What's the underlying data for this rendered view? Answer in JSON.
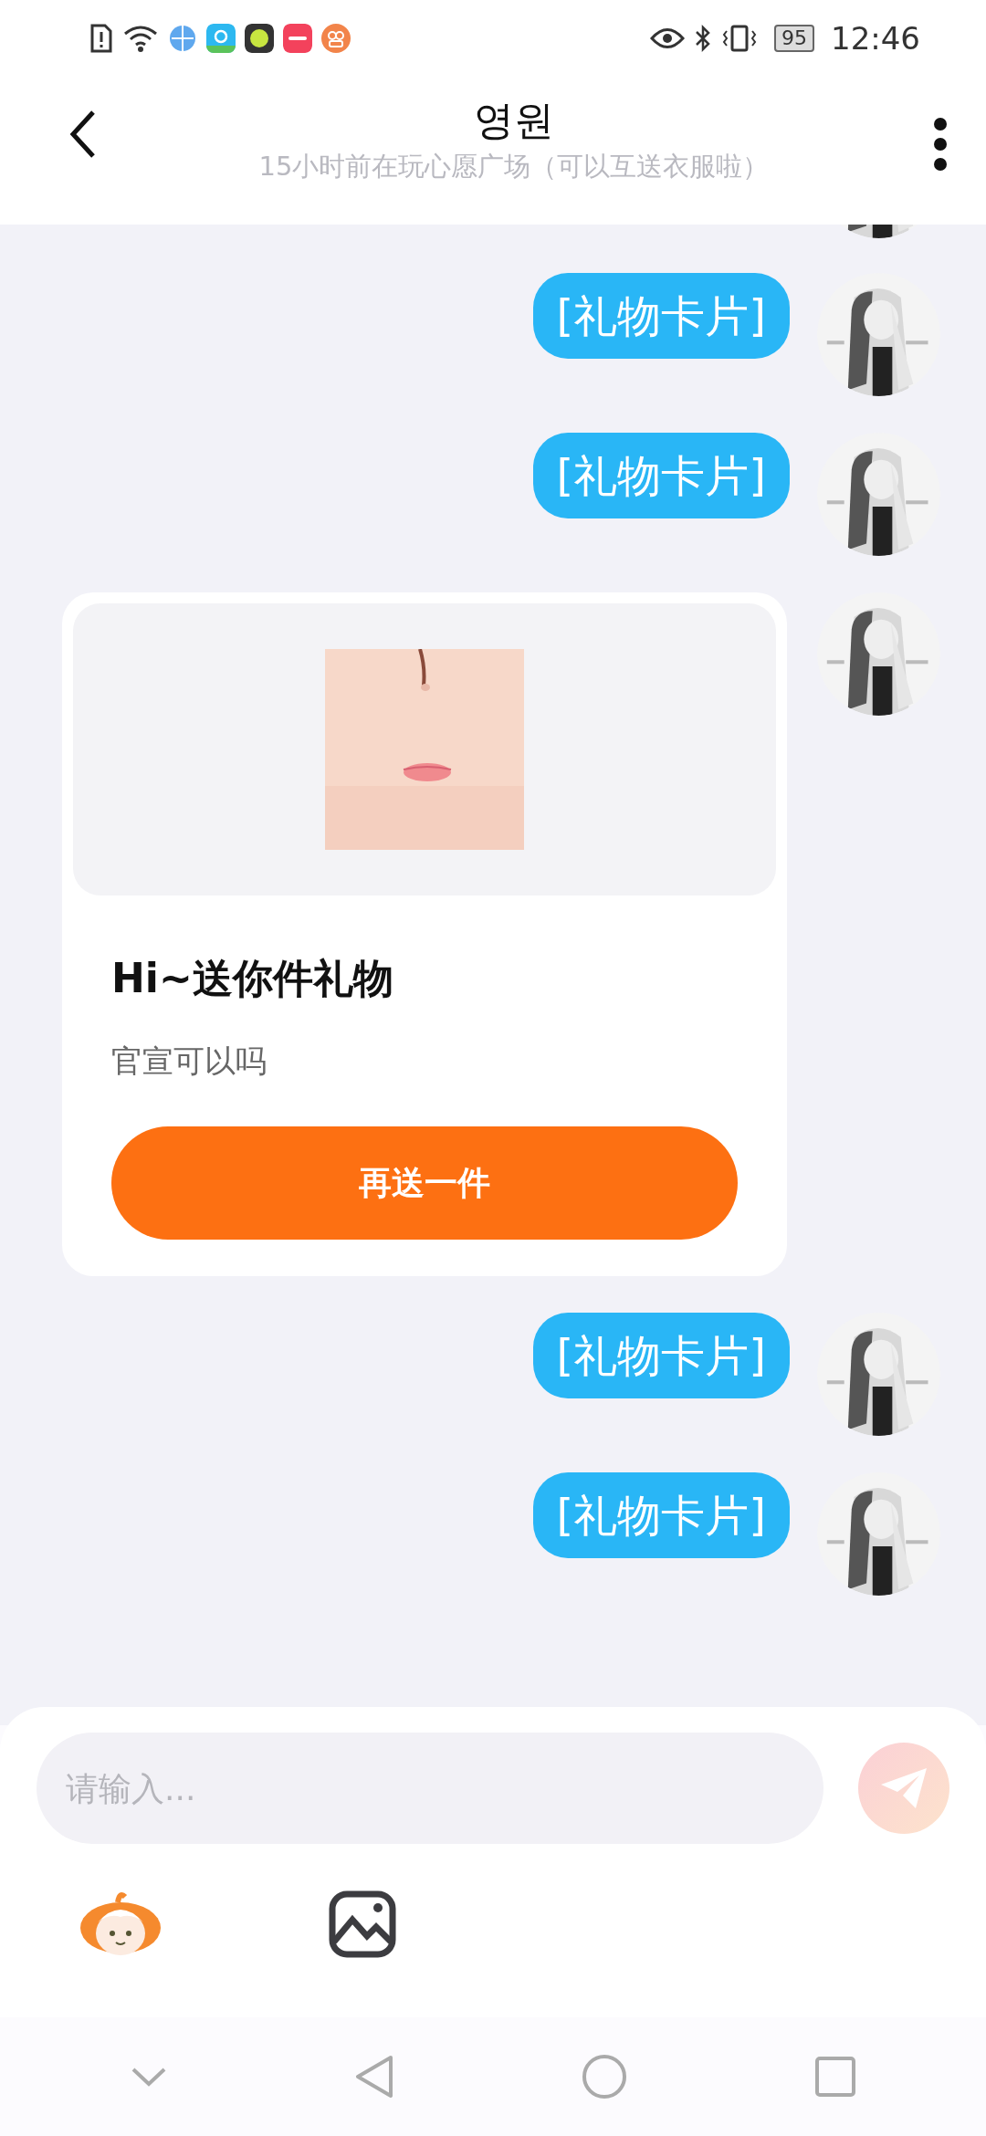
{
  "status_bar": {
    "battery": "95",
    "time": "12:46"
  },
  "header": {
    "title": "영원",
    "subtitle": "15小时前在玩心愿广场（可以互送衣服啦）"
  },
  "messages": [
    {
      "kind": "text",
      "text": "[礼物卡片]"
    },
    {
      "kind": "text",
      "text": "[礼物卡片]"
    },
    {
      "kind": "gift_card",
      "title": "Hi~送你件礼物",
      "message": "官宣可以吗",
      "button": "再送一件"
    },
    {
      "kind": "text",
      "text": "[礼物卡片]"
    },
    {
      "kind": "text",
      "text": "[礼物卡片]"
    }
  ],
  "composer": {
    "placeholder": "请输入..."
  }
}
